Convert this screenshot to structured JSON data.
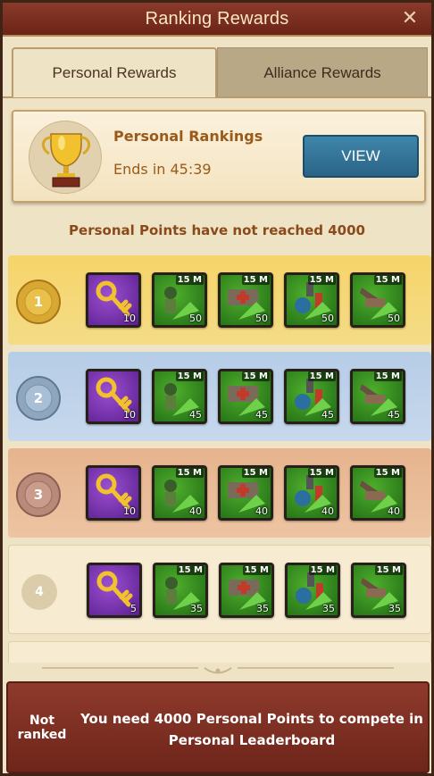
{
  "window": {
    "title": "Ranking Rewards",
    "close_glyph": "✕"
  },
  "tabs": [
    {
      "label": "Personal Rewards",
      "active": true
    },
    {
      "label": "Alliance Rewards",
      "active": false
    }
  ],
  "ranking_card": {
    "icon": "trophy-icon",
    "title": "Personal Rankings",
    "ends": "Ends in 45:39",
    "view_label": "VIEW"
  },
  "notice": "Personal Points have not reached 4000",
  "tiers": [
    {
      "rank": "1",
      "style": "gold",
      "items": [
        {
          "type": "key",
          "count": "10"
        },
        {
          "type": "troop-speedup",
          "duration": "15 M",
          "count": "50"
        },
        {
          "type": "healing-speedup",
          "duration": "15 M",
          "count": "50"
        },
        {
          "type": "research-speedup",
          "duration": "15 M",
          "count": "50"
        },
        {
          "type": "building-speedup",
          "duration": "15 M",
          "count": "50"
        }
      ]
    },
    {
      "rank": "2",
      "style": "silver",
      "items": [
        {
          "type": "key",
          "count": "10"
        },
        {
          "type": "troop-speedup",
          "duration": "15 M",
          "count": "45"
        },
        {
          "type": "healing-speedup",
          "duration": "15 M",
          "count": "45"
        },
        {
          "type": "research-speedup",
          "duration": "15 M",
          "count": "45"
        },
        {
          "type": "building-speedup",
          "duration": "15 M",
          "count": "45"
        }
      ]
    },
    {
      "rank": "3",
      "style": "bronze",
      "items": [
        {
          "type": "key",
          "count": "10"
        },
        {
          "type": "troop-speedup",
          "duration": "15 M",
          "count": "40"
        },
        {
          "type": "healing-speedup",
          "duration": "15 M",
          "count": "40"
        },
        {
          "type": "research-speedup",
          "duration": "15 M",
          "count": "40"
        },
        {
          "type": "building-speedup",
          "duration": "15 M",
          "count": "40"
        }
      ]
    },
    {
      "rank": "4",
      "style": "plain",
      "items": [
        {
          "type": "key",
          "count": "5"
        },
        {
          "type": "troop-speedup",
          "duration": "15 M",
          "count": "35"
        },
        {
          "type": "healing-speedup",
          "duration": "15 M",
          "count": "35"
        },
        {
          "type": "research-speedup",
          "duration": "15 M",
          "count": "35"
        },
        {
          "type": "building-speedup",
          "duration": "15 M",
          "count": "35"
        }
      ]
    }
  ],
  "footer": {
    "rank_status": "Not ranked",
    "message": "You need 4000 Personal Points to compete in Personal Leaderboard"
  },
  "colors": {
    "title_bar": "#7a2d1f",
    "accent_text": "#9a5a19",
    "view_button": "#2f6f95",
    "gold_tier": "#f6d46a",
    "silver_tier": "#b6cde7",
    "bronze_tier": "#e6b48e",
    "footer": "#7f2f22"
  }
}
